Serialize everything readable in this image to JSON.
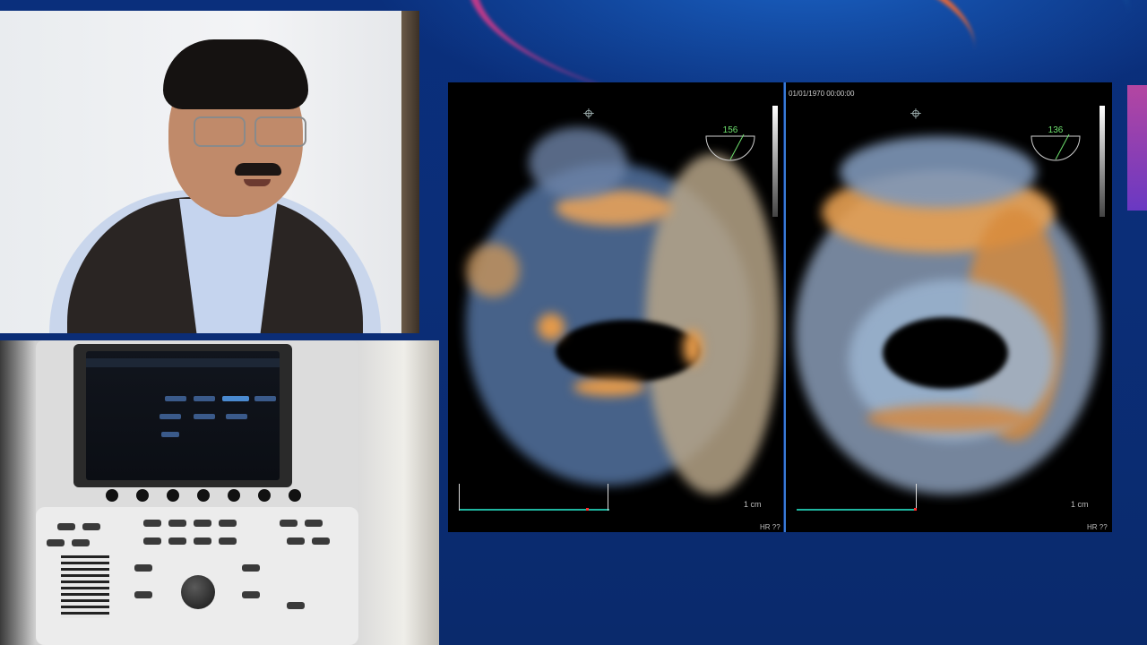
{
  "scene": {
    "description_colors": {
      "background": "#0a2a6a",
      "accent_orange": "#ff6a2a",
      "accent_magenta": "#d23a8a",
      "divider_blue": "#3a7bd5",
      "ecg_green": "#1fb6a0",
      "angle_green": "#6ee06e"
    }
  },
  "echo_left": {
    "angle_value": "156",
    "scale_text": "1 cm",
    "hr_text": "HR ??"
  },
  "echo_right": {
    "timestamp": "01/01/1970 00:00:00",
    "angle_value": "136",
    "scale_text": "1 cm",
    "hr_text": "HR ??"
  }
}
